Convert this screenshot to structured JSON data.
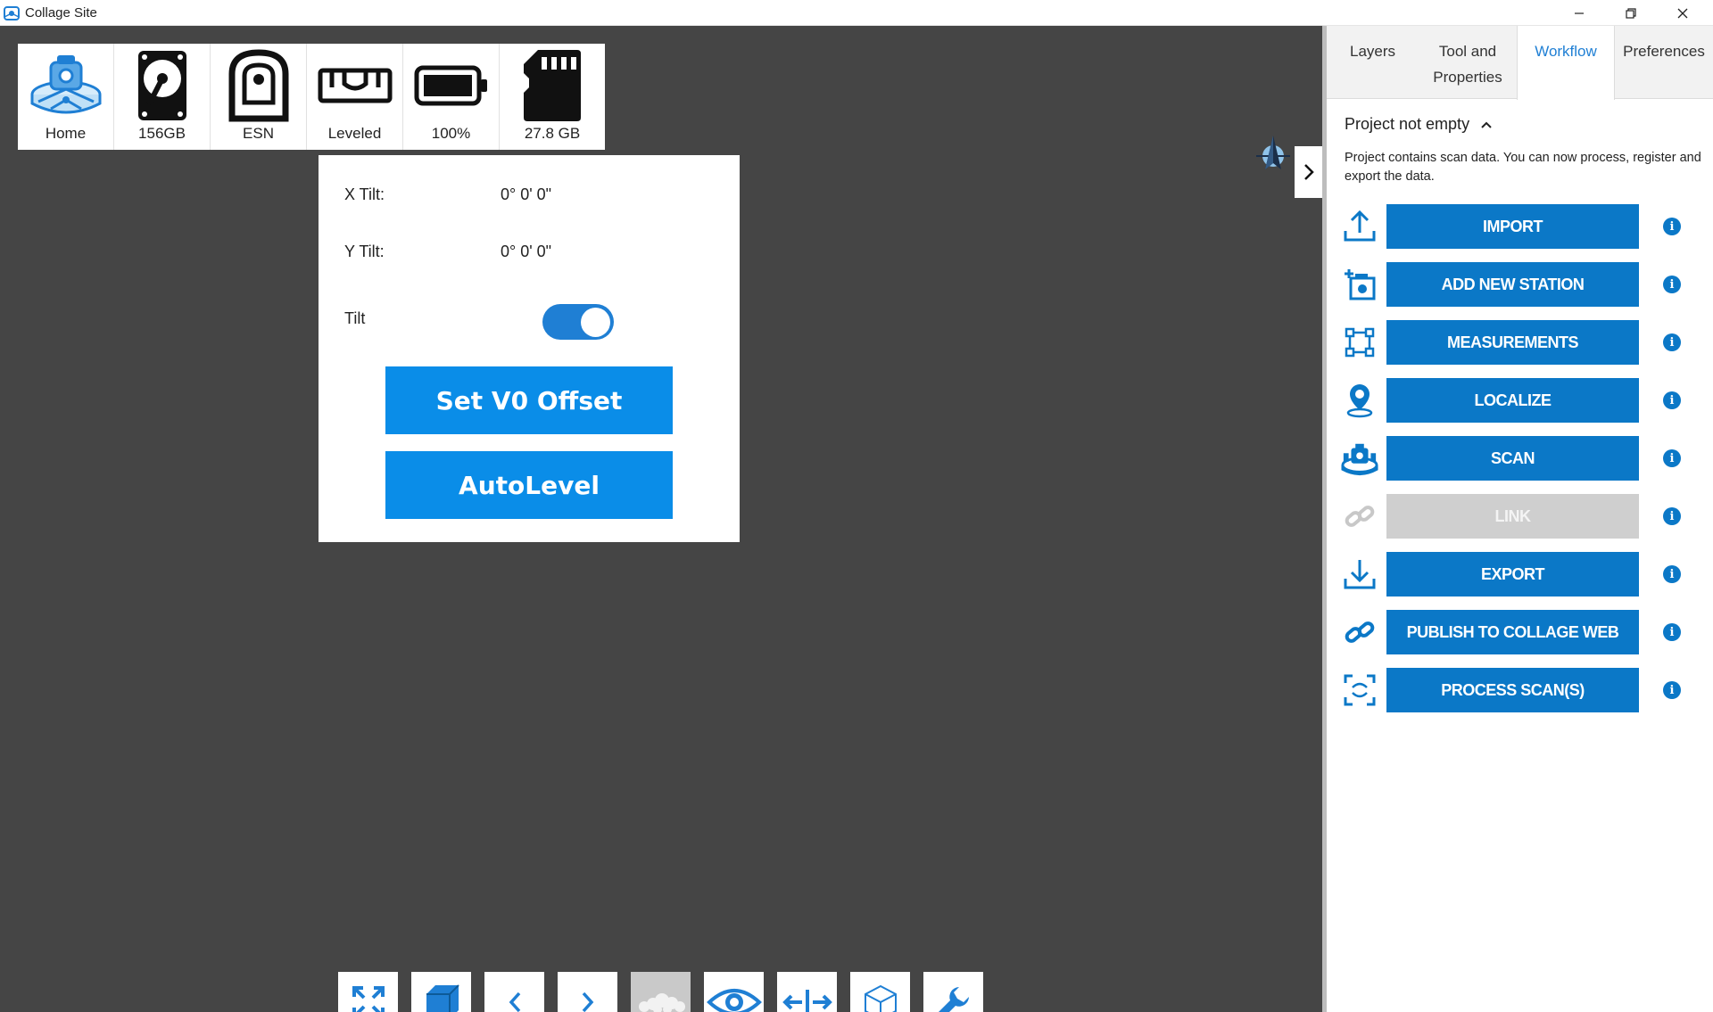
{
  "window": {
    "title": "Collage Site"
  },
  "status_bar": {
    "items": [
      {
        "label": "Home",
        "icon": "home-scanner-icon"
      },
      {
        "label": "156GB",
        "icon": "hard-drive-icon"
      },
      {
        "label": "ESN",
        "icon": "scanner-device-icon"
      },
      {
        "label": "Leveled",
        "icon": "level-bubble-icon"
      },
      {
        "label": "100%",
        "icon": "battery-icon"
      },
      {
        "label": "27.8 GB",
        "icon": "sd-card-icon"
      }
    ]
  },
  "tilt_popup": {
    "x_tilt_label": "X Tilt:",
    "x_tilt_value": "0° 0' 0\"",
    "y_tilt_label": "Y Tilt:",
    "y_tilt_value": "0° 0' 0\"",
    "tilt_label": "Tilt",
    "tilt_enabled": true,
    "set_v0_label": "Set V0 Offset",
    "autolevel_label": "AutoLevel"
  },
  "right_panel": {
    "tabs": [
      {
        "label_line1": "Layers",
        "label_line2": ""
      },
      {
        "label_line1": "Tool and",
        "label_line2": "Properties"
      },
      {
        "label_line1": "Workflow",
        "label_line2": ""
      },
      {
        "label_line1": "Preferences",
        "label_line2": ""
      }
    ],
    "active_tab": "Workflow",
    "project_status": "Project not empty",
    "project_description": "Project contains scan data. You can now process, register and export the data.",
    "workflow": [
      {
        "label": "IMPORT",
        "icon": "upload-icon",
        "enabled": true
      },
      {
        "label": "ADD NEW STATION",
        "icon": "add-station-icon",
        "enabled": true
      },
      {
        "label": "MEASUREMENTS",
        "icon": "measure-frame-icon",
        "enabled": true
      },
      {
        "label": "LOCALIZE",
        "icon": "location-pin-icon",
        "enabled": true
      },
      {
        "label": "SCAN",
        "icon": "scanner-icon",
        "enabled": true
      },
      {
        "label": "LINK",
        "icon": "link-icon",
        "enabled": false
      },
      {
        "label": "EXPORT",
        "icon": "download-icon",
        "enabled": true
      },
      {
        "label": "PUBLISH TO COLLAGE WEB",
        "icon": "publish-link-icon",
        "enabled": true
      },
      {
        "label": "PROCESS SCAN(S)",
        "icon": "process-scan-icon",
        "enabled": true
      }
    ],
    "info_glyph": "i"
  },
  "colors": {
    "accent": "#0b78c7",
    "popup_button": "#0a8de8",
    "viewport_bg": "#454545",
    "disabled": "#cfcfcf"
  }
}
